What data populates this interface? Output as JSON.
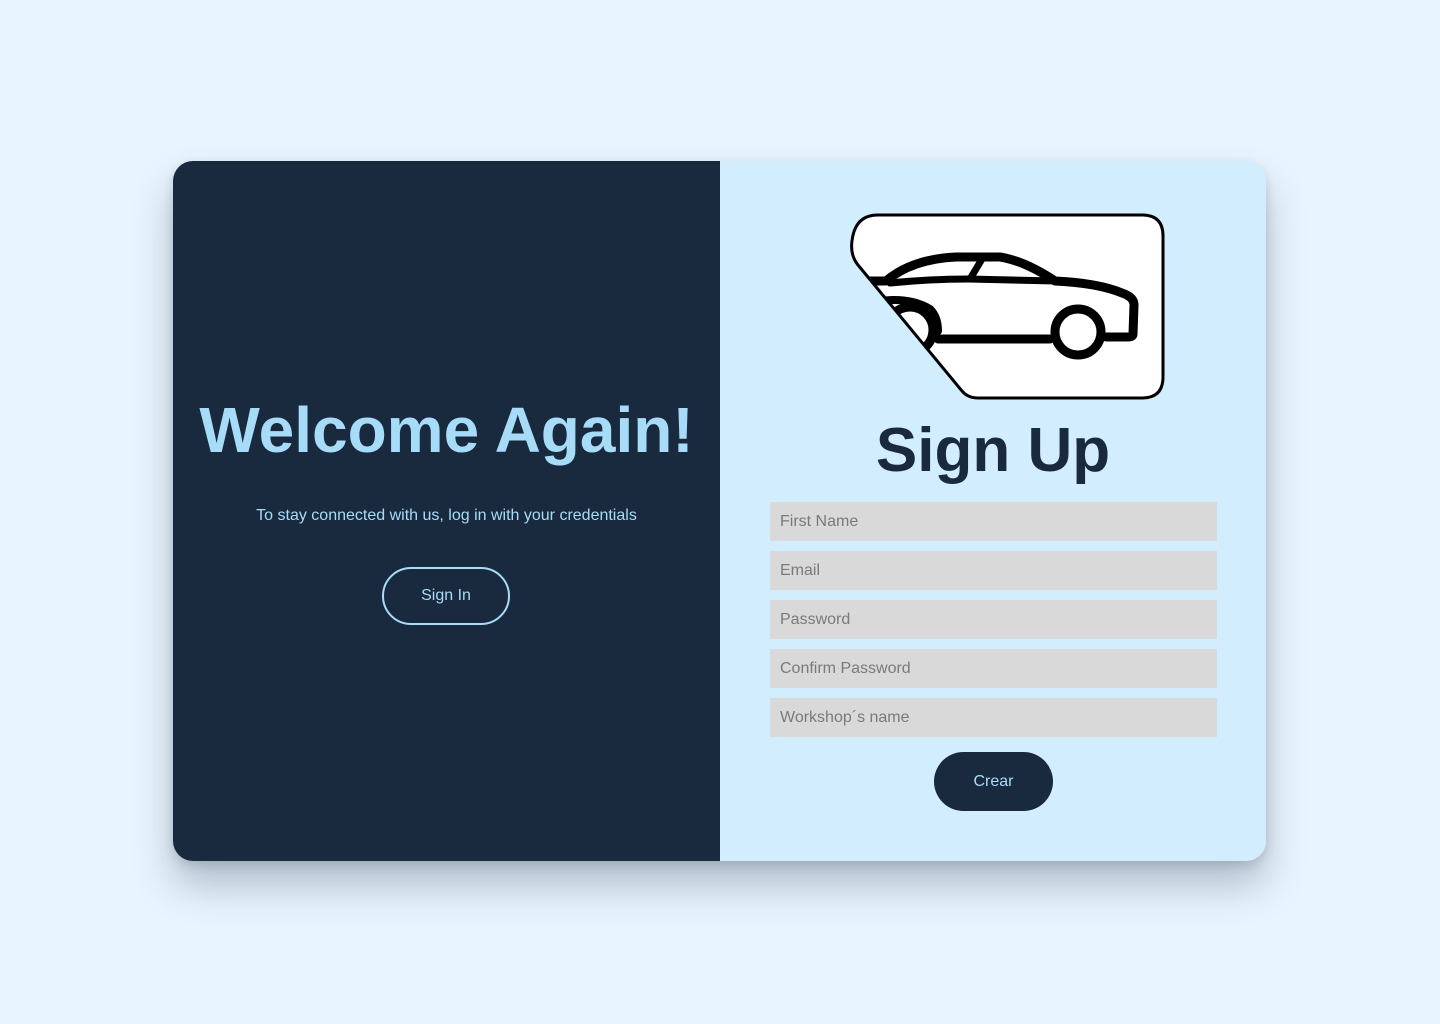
{
  "welcome": {
    "title": "Welcome Again!",
    "subtitle": "To stay connected with us, log in with your credentials",
    "signin_label": "Sign In"
  },
  "signup": {
    "logo_icon": "car-icon",
    "title": "Sign Up",
    "fields": [
      {
        "placeholder": "First Name",
        "value": ""
      },
      {
        "placeholder": "Email",
        "value": ""
      },
      {
        "placeholder": "Password",
        "value": ""
      },
      {
        "placeholder": "Confirm Password",
        "value": ""
      },
      {
        "placeholder": "Workshop´s name",
        "value": ""
      }
    ],
    "submit_label": "Crear"
  },
  "colors": {
    "page_background": "#e8f5ff",
    "dark_panel": "#1a2a3e",
    "light_panel": "#d2edfd",
    "accent": "#a6dcf8",
    "input_background": "#d9d9d9"
  }
}
